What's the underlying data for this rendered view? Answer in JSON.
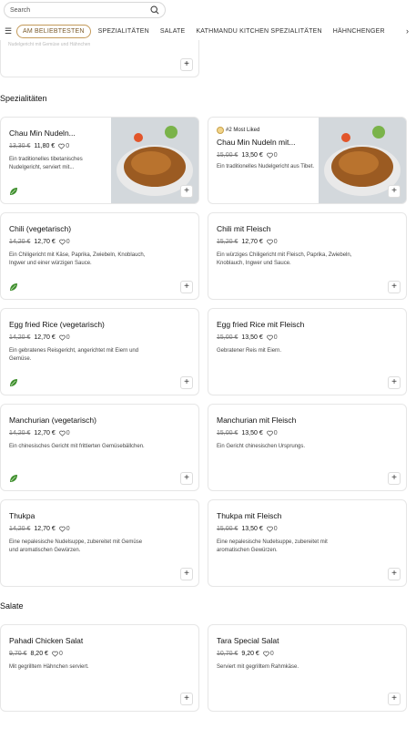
{
  "search": {
    "placeholder": "Search"
  },
  "nav": {
    "tabs": [
      "AM BELIEBTESTEN",
      "SPEZIALITÄTEN",
      "SALATE",
      "KATHMANDU KITCHEN SPEZIALITÄTEN",
      "HÄHNCHENGER"
    ]
  },
  "top_card": {
    "faded_text": "Nudelgericht mit Gemüse und Hähnchen"
  },
  "sections": [
    {
      "title": "Spezialitäten",
      "items": [
        {
          "name": "Chau Min Nudeln...",
          "old_price": "13,30 €",
          "price": "11,80 €",
          "likes": "0",
          "desc": "Ein traditionelles tibetanisches Nudelgericht, serviert mit...",
          "veg": true,
          "image": true,
          "badge": ""
        },
        {
          "name": "Chau Min Nudeln mit...",
          "old_price": "15,00 €",
          "price": "13,50 €",
          "likes": "0",
          "desc": "Ein traditionelles Nudelgericht aus Tibet.",
          "veg": false,
          "image": true,
          "badge": "#2 Most Liked"
        },
        {
          "name": "Chili (vegetarisch)",
          "old_price": "14,20 €",
          "price": "12,70 €",
          "likes": "0",
          "desc": "Ein Chiligericht mit Käse, Paprika, Zwiebeln, Knoblauch, Ingwer und einer würzigen Sauce.",
          "veg": true
        },
        {
          "name": "Chili mit Fleisch",
          "old_price": "15,20 €",
          "price": "12,70 €",
          "likes": "0",
          "desc": "Ein würziges Chiligericht mit Fleisch, Paprika, Zwiebeln, Knoblauch, Ingwer und Sauce.",
          "veg": false
        },
        {
          "name": "Egg fried Rice (vegetarisch)",
          "old_price": "14,20 €",
          "price": "12,70 €",
          "likes": "0",
          "desc": "Ein gebratenes Reisgericht, angerichtet mit Eiern und Gemüse.",
          "veg": true
        },
        {
          "name": "Egg fried Rice mit Fleisch",
          "old_price": "15,00 €",
          "price": "13,50 €",
          "likes": "0",
          "desc": "Gebratener Reis mit Eiern.",
          "veg": false
        },
        {
          "name": "Manchurian (vegetarisch)",
          "old_price": "14,20 €",
          "price": "12,70 €",
          "likes": "0",
          "desc": "Ein chinesisches Gericht mit frittierten Gemüsebällchen.",
          "veg": true
        },
        {
          "name": "Manchurian mit Fleisch",
          "old_price": "15,00 €",
          "price": "13,50 €",
          "likes": "0",
          "desc": "Ein Gericht chinesischen Ursprungs.",
          "veg": false
        },
        {
          "name": "Thukpa",
          "old_price": "14,20 €",
          "price": "12,70 €",
          "likes": "0",
          "desc": "Eine nepalesische Nudelsuppe, zubereitet mit Gemüse und aromatischen Gewürzen.",
          "veg": false
        },
        {
          "name": "Thukpa mit Fleisch",
          "old_price": "15,00 €",
          "price": "13,50 €",
          "likes": "0",
          "desc": "Eine nepalesische Nudelsuppe, zubereitet mit aromatischen Gewürzen.",
          "veg": false
        }
      ]
    },
    {
      "title": "Salate",
      "items": [
        {
          "name": "Pahadi Chicken Salat",
          "old_price": "9,70 €",
          "price": "8,20 €",
          "likes": "0",
          "desc": "Mit gegrilltem Hähnchen serviert.",
          "veg": false
        },
        {
          "name": "Tara Special Salat",
          "old_price": "10,70 €",
          "price": "9,20 €",
          "likes": "0",
          "desc": "Serviert mit gegrilltem Rahmkäse.",
          "veg": false
        }
      ]
    }
  ],
  "colors": {
    "accent": "#c49a5a",
    "veg_leaf": "#3f8f2e",
    "border": "#e6e6e6"
  },
  "icons": {
    "search": "search-icon",
    "menu": "menu-icon",
    "next": "chevron-right-icon",
    "add": "plus-icon",
    "heart": "heart-icon",
    "leaf": "leaf-icon",
    "badge": "medal-icon"
  }
}
